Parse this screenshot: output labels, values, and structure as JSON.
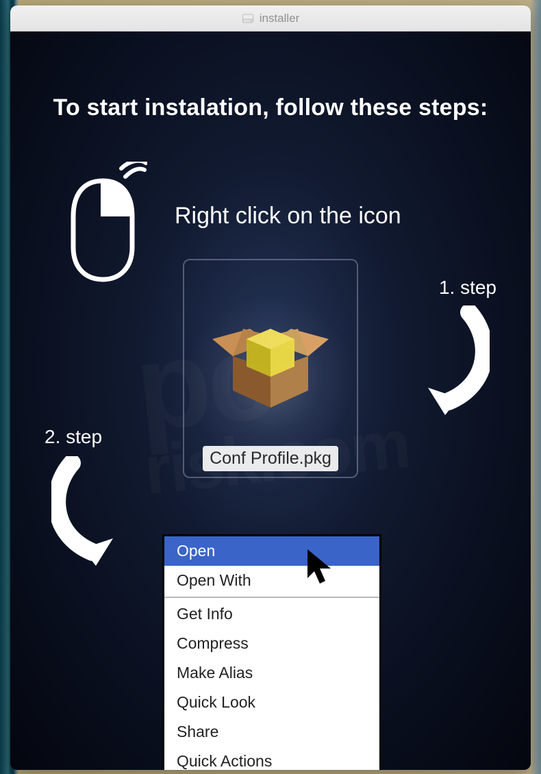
{
  "window": {
    "title": "installer"
  },
  "heading": "To start instalation, follow these steps:",
  "instruction": "Right click on the icon",
  "package": {
    "filename": "Conf Profile.pkg"
  },
  "steps": {
    "one": "1. step",
    "two": "2. step"
  },
  "context_menu": {
    "highlighted": "Open",
    "group1": [
      "Open With"
    ],
    "group2": [
      "Get Info",
      "Compress",
      "Make Alias",
      "Quick Look",
      "Share",
      "Quick Actions"
    ]
  }
}
